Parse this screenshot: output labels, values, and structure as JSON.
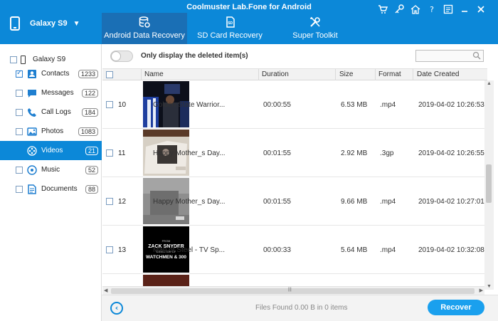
{
  "window": {
    "title": "Coolmuster Lab.Fone for Android",
    "controls": [
      "cart-icon",
      "key-icon",
      "home-icon",
      "help-icon",
      "feedback-icon",
      "minimize-icon",
      "close-icon"
    ]
  },
  "device": {
    "name": "Galaxy S9"
  },
  "tabs": [
    {
      "label": "Android Data Recovery",
      "icon": "recovery-db-icon",
      "active": true
    },
    {
      "label": "SD Card Recovery",
      "icon": "sd-card-icon",
      "active": false
    },
    {
      "label": "Super Toolkit",
      "icon": "toolkit-icon",
      "active": false
    }
  ],
  "sidebar": {
    "root": {
      "label": "Galaxy S9"
    },
    "items": [
      {
        "label": "Contacts",
        "count": "1233",
        "icon": "contacts-icon",
        "checked": true,
        "active": false
      },
      {
        "label": "Messages",
        "count": "122",
        "icon": "messages-icon",
        "checked": false,
        "active": false
      },
      {
        "label": "Call Logs",
        "count": "184",
        "icon": "phone-icon",
        "checked": false,
        "active": false
      },
      {
        "label": "Photos",
        "count": "1083",
        "icon": "photos-icon",
        "checked": false,
        "active": false
      },
      {
        "label": "Videos",
        "count": "21",
        "icon": "videos-icon",
        "checked": false,
        "active": true
      },
      {
        "label": "Music",
        "count": "52",
        "icon": "music-icon",
        "checked": false,
        "active": false
      },
      {
        "label": "Documents",
        "count": "88",
        "icon": "documents-icon",
        "checked": false,
        "active": false
      }
    ]
  },
  "filter": {
    "toggle_label": "Only display the deleted item(s)",
    "toggle_on": false
  },
  "search": {
    "placeholder": ""
  },
  "table": {
    "headers": {
      "name": "Name",
      "duration": "Duration",
      "size": "Size",
      "format": "Format",
      "date": "Date Created"
    },
    "rows": [
      {
        "num": "10",
        "name": "Golden State Warrior...",
        "duration": "00:00:55",
        "size": "6.53 MB",
        "format": ".mp4",
        "date": "2019-04-02 10:26:53",
        "thumb": "basketball"
      },
      {
        "num": "11",
        "name": "Happy Mother_s Day...",
        "duration": "00:01:55",
        "size": "2.92 MB",
        "format": ".3gp",
        "date": "2019-04-02 10:26:55",
        "thumb": "photo-book"
      },
      {
        "num": "12",
        "name": "Happy Mother_s Day...",
        "duration": "00:01:55",
        "size": "9.66 MB",
        "format": ".mp4",
        "date": "2019-04-02 10:27:01",
        "thumb": "gray-photo"
      },
      {
        "num": "13",
        "name": "Man of Steel - TV Sp...",
        "duration": "00:00:33",
        "size": "5.64 MB",
        "format": ".mp4",
        "date": "2019-04-02 10:32:08",
        "thumb": "title-card"
      }
    ],
    "thumb_text": {
      "line1": "FROM",
      "line2": "ZACK SNYDER",
      "line3": "DIRECTOR OF",
      "line4": "WATCHMEN & 300"
    }
  },
  "footer": {
    "status": "Files Found 0.00 B in 0 items",
    "recover_label": "Recover"
  },
  "colors": {
    "accent": "#0c88d8",
    "tab_active": "#1a6fb5",
    "recover": "#1aa0ee"
  }
}
